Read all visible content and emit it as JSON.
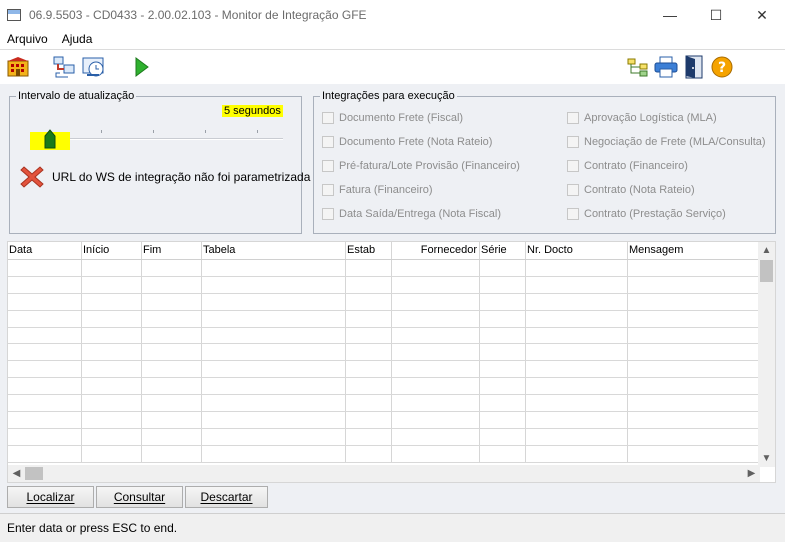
{
  "window": {
    "title": "06.9.5503 - CD0433 - 2.00.02.103 - Monitor de Integração GFE",
    "minimize": "—",
    "maximize": "☐",
    "close": "✕"
  },
  "menu": {
    "items": [
      "Arquivo",
      "Ajuda"
    ]
  },
  "toolbar": {
    "icons": [
      "building-icon",
      "network-config-icon",
      "schedule-monitor-icon",
      "play-icon",
      "tree-structure-icon",
      "printer-icon",
      "exit-door-icon",
      "help-icon"
    ]
  },
  "interval": {
    "legend": "Intervalo de atualização",
    "value_label": "5 segundos",
    "value_seconds": 5,
    "error_text": "URL do WS de integração não foi parametrizada"
  },
  "integrations": {
    "legend": "Integrações para execução",
    "left": [
      "Documento Frete (Fiscal)",
      "Documento Frete (Nota Rateio)",
      "Pré-fatura/Lote Provisão (Financeiro)",
      "Fatura (Financeiro)",
      "Data Saída/Entrega (Nota Fiscal)"
    ],
    "right": [
      "Aprovação Logística (MLA)",
      "Negociação de Frete (MLA/Consulta)",
      "Contrato (Financeiro)",
      "Contrato (Nota Rateio)",
      "Contrato (Prestação Serviço)"
    ]
  },
  "grid": {
    "columns": [
      "Data",
      "Início",
      "Fim",
      "Tabela",
      "Estab",
      "Fornecedor",
      "Série",
      "Nr. Docto",
      "Mensagem"
    ],
    "rows": []
  },
  "buttons": {
    "localizar": "Localizar",
    "consultar": "Consultar",
    "descartar": "Descartar"
  },
  "status": {
    "text": "Enter data or press ESC to end."
  },
  "colors": {
    "highlight": "#ffff00",
    "panel_bg": "#eef0f4",
    "error_red": "#e2533d"
  }
}
